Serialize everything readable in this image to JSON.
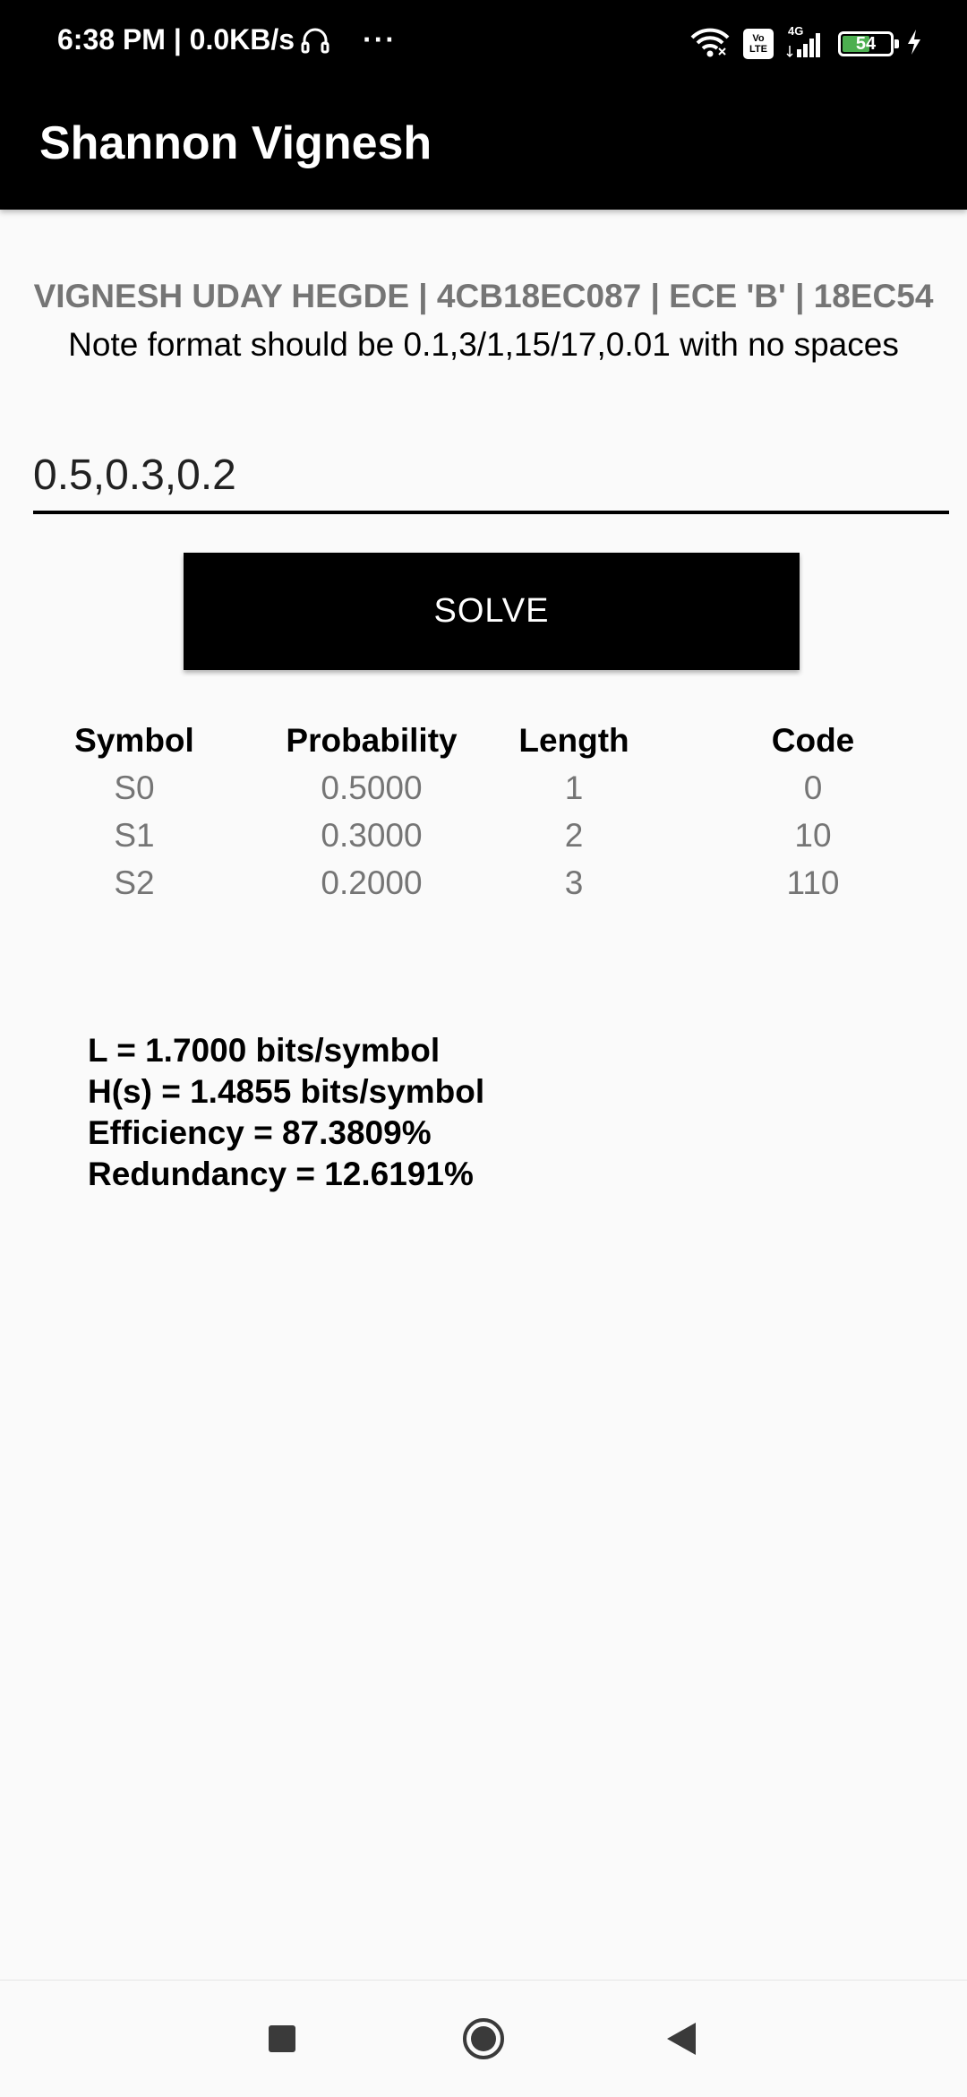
{
  "status_bar": {
    "time_speed": "6:38 PM | 0.0KB/s",
    "more": "···",
    "network_type": "4G",
    "volte_line1": "Vo",
    "volte_line2": "LTE",
    "battery_level": "54"
  },
  "app_bar": {
    "title": "Shannon Vignesh"
  },
  "content": {
    "header": "VIGNESH UDAY HEGDE | 4CB18EC087 | ECE 'B' | 18EC54",
    "note": "Note format should be 0.1,3/1,15/17,0.01 with no spaces",
    "input_value": "0.5,0.3,0.2",
    "solve_label": "SOLVE"
  },
  "table": {
    "headers": [
      "Symbol",
      "Probability",
      "Length",
      "Code"
    ],
    "rows": [
      [
        "S0",
        "0.5000",
        "1",
        "0"
      ],
      [
        "S1",
        "0.3000",
        "2",
        "10"
      ],
      [
        "S2",
        "0.2000",
        "3",
        "110"
      ]
    ]
  },
  "stats": {
    "avg_length": "L = 1.7000 bits/symbol",
    "entropy": "H(s) = 1.4855 bits/symbol",
    "efficiency": "Efficiency = 87.3809%",
    "redundancy": "Redundancy = 12.6191%"
  },
  "colors": {
    "bar_background": "#000000",
    "page_background": "#fafafa",
    "muted_text": "#757575",
    "battery_fill": "#4caf50"
  },
  "icons": [
    "headset-icon",
    "more-icon",
    "wifi-icon",
    "volte-icon",
    "signal-icon",
    "battery-icon",
    "charging-icon",
    "nav-recents-icon",
    "nav-home-icon",
    "nav-back-icon"
  ]
}
